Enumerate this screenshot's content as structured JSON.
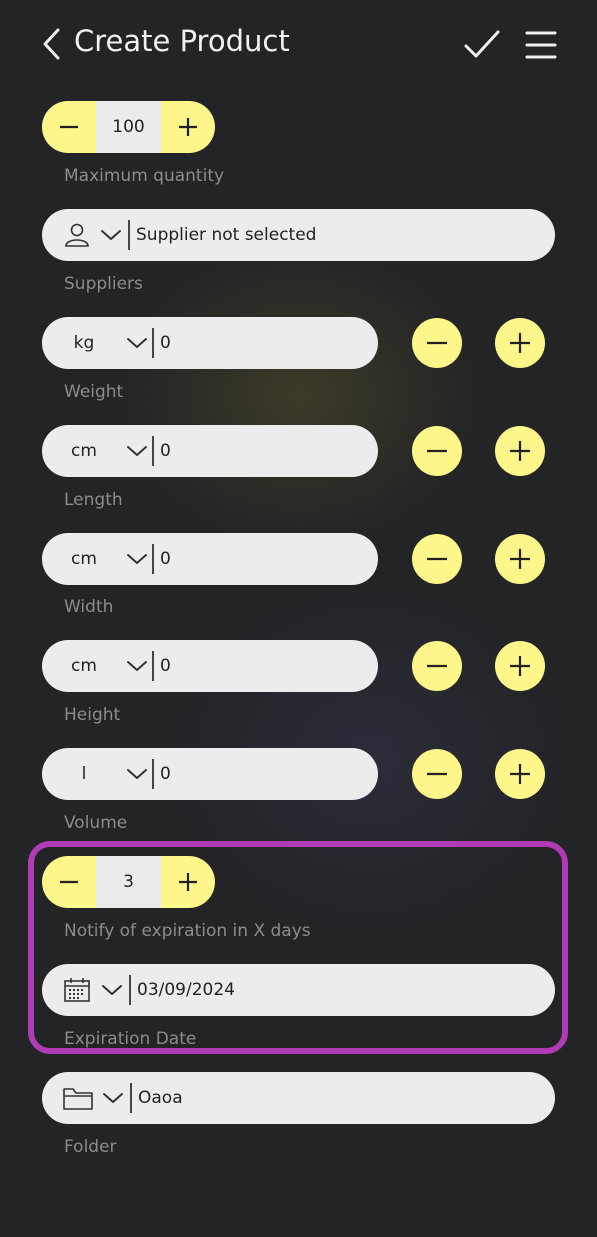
{
  "header": {
    "title": "Create Product"
  },
  "max_qty": {
    "value": "100",
    "label": "Maximum quantity"
  },
  "suppliers": {
    "value": "Supplier not selected",
    "label": "Suppliers"
  },
  "weight": {
    "unit": "kg",
    "value": "0",
    "label": "Weight"
  },
  "length": {
    "unit": "cm",
    "value": "0",
    "label": "Length"
  },
  "width": {
    "unit": "cm",
    "value": "0",
    "label": "Width"
  },
  "height": {
    "unit": "cm",
    "value": "0",
    "label": "Height"
  },
  "volume": {
    "unit": "l",
    "value": "0",
    "label": "Volume"
  },
  "notify": {
    "value": "3",
    "label": "Notify of expiration in X days"
  },
  "expiration": {
    "value": "03/09/2024",
    "label": "Expiration Date"
  },
  "folder": {
    "value": "Oaoa",
    "label": "Folder"
  },
  "colors": {
    "accent": "#fdf68a",
    "highlight": "#b03bb5",
    "field": "#ececec",
    "label": "#8c8c8c"
  }
}
